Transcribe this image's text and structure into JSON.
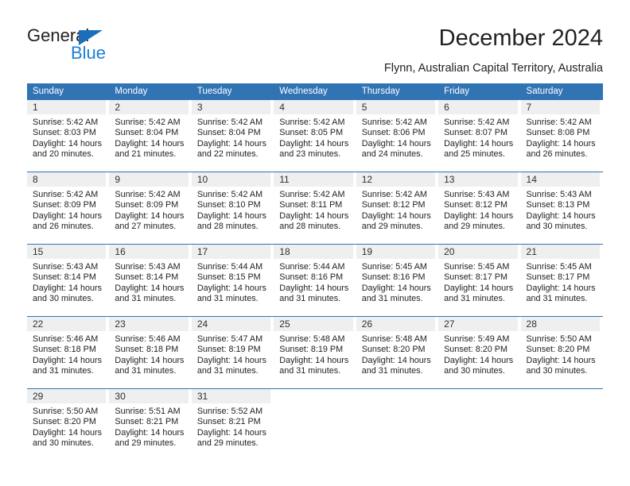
{
  "brand": {
    "name_part1": "General",
    "name_part2": "Blue",
    "accent_color": "#1b7fd4",
    "header_color": "#3174b4"
  },
  "header": {
    "title": "December 2024",
    "subtitle": "Flynn, Australian Capital Territory, Australia"
  },
  "weekdays": [
    "Sunday",
    "Monday",
    "Tuesday",
    "Wednesday",
    "Thursday",
    "Friday",
    "Saturday"
  ],
  "weeks": [
    [
      {
        "day": "1",
        "sunrise": "Sunrise: 5:42 AM",
        "sunset": "Sunset: 8:03 PM",
        "daylight1": "Daylight: 14 hours",
        "daylight2": "and 20 minutes."
      },
      {
        "day": "2",
        "sunrise": "Sunrise: 5:42 AM",
        "sunset": "Sunset: 8:04 PM",
        "daylight1": "Daylight: 14 hours",
        "daylight2": "and 21 minutes."
      },
      {
        "day": "3",
        "sunrise": "Sunrise: 5:42 AM",
        "sunset": "Sunset: 8:04 PM",
        "daylight1": "Daylight: 14 hours",
        "daylight2": "and 22 minutes."
      },
      {
        "day": "4",
        "sunrise": "Sunrise: 5:42 AM",
        "sunset": "Sunset: 8:05 PM",
        "daylight1": "Daylight: 14 hours",
        "daylight2": "and 23 minutes."
      },
      {
        "day": "5",
        "sunrise": "Sunrise: 5:42 AM",
        "sunset": "Sunset: 8:06 PM",
        "daylight1": "Daylight: 14 hours",
        "daylight2": "and 24 minutes."
      },
      {
        "day": "6",
        "sunrise": "Sunrise: 5:42 AM",
        "sunset": "Sunset: 8:07 PM",
        "daylight1": "Daylight: 14 hours",
        "daylight2": "and 25 minutes."
      },
      {
        "day": "7",
        "sunrise": "Sunrise: 5:42 AM",
        "sunset": "Sunset: 8:08 PM",
        "daylight1": "Daylight: 14 hours",
        "daylight2": "and 26 minutes."
      }
    ],
    [
      {
        "day": "8",
        "sunrise": "Sunrise: 5:42 AM",
        "sunset": "Sunset: 8:09 PM",
        "daylight1": "Daylight: 14 hours",
        "daylight2": "and 26 minutes."
      },
      {
        "day": "9",
        "sunrise": "Sunrise: 5:42 AM",
        "sunset": "Sunset: 8:09 PM",
        "daylight1": "Daylight: 14 hours",
        "daylight2": "and 27 minutes."
      },
      {
        "day": "10",
        "sunrise": "Sunrise: 5:42 AM",
        "sunset": "Sunset: 8:10 PM",
        "daylight1": "Daylight: 14 hours",
        "daylight2": "and 28 minutes."
      },
      {
        "day": "11",
        "sunrise": "Sunrise: 5:42 AM",
        "sunset": "Sunset: 8:11 PM",
        "daylight1": "Daylight: 14 hours",
        "daylight2": "and 28 minutes."
      },
      {
        "day": "12",
        "sunrise": "Sunrise: 5:42 AM",
        "sunset": "Sunset: 8:12 PM",
        "daylight1": "Daylight: 14 hours",
        "daylight2": "and 29 minutes."
      },
      {
        "day": "13",
        "sunrise": "Sunrise: 5:43 AM",
        "sunset": "Sunset: 8:12 PM",
        "daylight1": "Daylight: 14 hours",
        "daylight2": "and 29 minutes."
      },
      {
        "day": "14",
        "sunrise": "Sunrise: 5:43 AM",
        "sunset": "Sunset: 8:13 PM",
        "daylight1": "Daylight: 14 hours",
        "daylight2": "and 30 minutes."
      }
    ],
    [
      {
        "day": "15",
        "sunrise": "Sunrise: 5:43 AM",
        "sunset": "Sunset: 8:14 PM",
        "daylight1": "Daylight: 14 hours",
        "daylight2": "and 30 minutes."
      },
      {
        "day": "16",
        "sunrise": "Sunrise: 5:43 AM",
        "sunset": "Sunset: 8:14 PM",
        "daylight1": "Daylight: 14 hours",
        "daylight2": "and 31 minutes."
      },
      {
        "day": "17",
        "sunrise": "Sunrise: 5:44 AM",
        "sunset": "Sunset: 8:15 PM",
        "daylight1": "Daylight: 14 hours",
        "daylight2": "and 31 minutes."
      },
      {
        "day": "18",
        "sunrise": "Sunrise: 5:44 AM",
        "sunset": "Sunset: 8:16 PM",
        "daylight1": "Daylight: 14 hours",
        "daylight2": "and 31 minutes."
      },
      {
        "day": "19",
        "sunrise": "Sunrise: 5:45 AM",
        "sunset": "Sunset: 8:16 PM",
        "daylight1": "Daylight: 14 hours",
        "daylight2": "and 31 minutes."
      },
      {
        "day": "20",
        "sunrise": "Sunrise: 5:45 AM",
        "sunset": "Sunset: 8:17 PM",
        "daylight1": "Daylight: 14 hours",
        "daylight2": "and 31 minutes."
      },
      {
        "day": "21",
        "sunrise": "Sunrise: 5:45 AM",
        "sunset": "Sunset: 8:17 PM",
        "daylight1": "Daylight: 14 hours",
        "daylight2": "and 31 minutes."
      }
    ],
    [
      {
        "day": "22",
        "sunrise": "Sunrise: 5:46 AM",
        "sunset": "Sunset: 8:18 PM",
        "daylight1": "Daylight: 14 hours",
        "daylight2": "and 31 minutes."
      },
      {
        "day": "23",
        "sunrise": "Sunrise: 5:46 AM",
        "sunset": "Sunset: 8:18 PM",
        "daylight1": "Daylight: 14 hours",
        "daylight2": "and 31 minutes."
      },
      {
        "day": "24",
        "sunrise": "Sunrise: 5:47 AM",
        "sunset": "Sunset: 8:19 PM",
        "daylight1": "Daylight: 14 hours",
        "daylight2": "and 31 minutes."
      },
      {
        "day": "25",
        "sunrise": "Sunrise: 5:48 AM",
        "sunset": "Sunset: 8:19 PM",
        "daylight1": "Daylight: 14 hours",
        "daylight2": "and 31 minutes."
      },
      {
        "day": "26",
        "sunrise": "Sunrise: 5:48 AM",
        "sunset": "Sunset: 8:20 PM",
        "daylight1": "Daylight: 14 hours",
        "daylight2": "and 31 minutes."
      },
      {
        "day": "27",
        "sunrise": "Sunrise: 5:49 AM",
        "sunset": "Sunset: 8:20 PM",
        "daylight1": "Daylight: 14 hours",
        "daylight2": "and 30 minutes."
      },
      {
        "day": "28",
        "sunrise": "Sunrise: 5:50 AM",
        "sunset": "Sunset: 8:20 PM",
        "daylight1": "Daylight: 14 hours",
        "daylight2": "and 30 minutes."
      }
    ],
    [
      {
        "day": "29",
        "sunrise": "Sunrise: 5:50 AM",
        "sunset": "Sunset: 8:20 PM",
        "daylight1": "Daylight: 14 hours",
        "daylight2": "and 30 minutes."
      },
      {
        "day": "30",
        "sunrise": "Sunrise: 5:51 AM",
        "sunset": "Sunset: 8:21 PM",
        "daylight1": "Daylight: 14 hours",
        "daylight2": "and 29 minutes."
      },
      {
        "day": "31",
        "sunrise": "Sunrise: 5:52 AM",
        "sunset": "Sunset: 8:21 PM",
        "daylight1": "Daylight: 14 hours",
        "daylight2": "and 29 minutes."
      },
      {
        "day": "",
        "sunrise": "",
        "sunset": "",
        "daylight1": "",
        "daylight2": ""
      },
      {
        "day": "",
        "sunrise": "",
        "sunset": "",
        "daylight1": "",
        "daylight2": ""
      },
      {
        "day": "",
        "sunrise": "",
        "sunset": "",
        "daylight1": "",
        "daylight2": ""
      },
      {
        "day": "",
        "sunrise": "",
        "sunset": "",
        "daylight1": "",
        "daylight2": ""
      }
    ]
  ]
}
